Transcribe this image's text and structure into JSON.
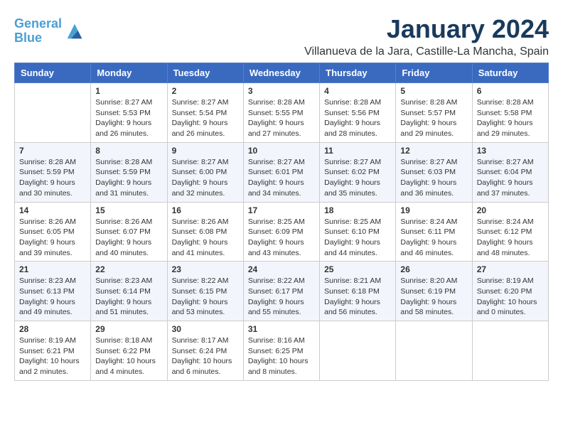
{
  "header": {
    "logo_line1": "General",
    "logo_line2": "Blue",
    "title": "January 2024",
    "subtitle": "Villanueva de la Jara, Castille-La Mancha, Spain"
  },
  "weekdays": [
    "Sunday",
    "Monday",
    "Tuesday",
    "Wednesday",
    "Thursday",
    "Friday",
    "Saturday"
  ],
  "weeks": [
    [
      {
        "day": "",
        "info": ""
      },
      {
        "day": "1",
        "info": "Sunrise: 8:27 AM\nSunset: 5:53 PM\nDaylight: 9 hours\nand 26 minutes."
      },
      {
        "day": "2",
        "info": "Sunrise: 8:27 AM\nSunset: 5:54 PM\nDaylight: 9 hours\nand 26 minutes."
      },
      {
        "day": "3",
        "info": "Sunrise: 8:28 AM\nSunset: 5:55 PM\nDaylight: 9 hours\nand 27 minutes."
      },
      {
        "day": "4",
        "info": "Sunrise: 8:28 AM\nSunset: 5:56 PM\nDaylight: 9 hours\nand 28 minutes."
      },
      {
        "day": "5",
        "info": "Sunrise: 8:28 AM\nSunset: 5:57 PM\nDaylight: 9 hours\nand 29 minutes."
      },
      {
        "day": "6",
        "info": "Sunrise: 8:28 AM\nSunset: 5:58 PM\nDaylight: 9 hours\nand 29 minutes."
      }
    ],
    [
      {
        "day": "7",
        "info": "Sunrise: 8:28 AM\nSunset: 5:59 PM\nDaylight: 9 hours\nand 30 minutes."
      },
      {
        "day": "8",
        "info": "Sunrise: 8:28 AM\nSunset: 5:59 PM\nDaylight: 9 hours\nand 31 minutes."
      },
      {
        "day": "9",
        "info": "Sunrise: 8:27 AM\nSunset: 6:00 PM\nDaylight: 9 hours\nand 32 minutes."
      },
      {
        "day": "10",
        "info": "Sunrise: 8:27 AM\nSunset: 6:01 PM\nDaylight: 9 hours\nand 34 minutes."
      },
      {
        "day": "11",
        "info": "Sunrise: 8:27 AM\nSunset: 6:02 PM\nDaylight: 9 hours\nand 35 minutes."
      },
      {
        "day": "12",
        "info": "Sunrise: 8:27 AM\nSunset: 6:03 PM\nDaylight: 9 hours\nand 36 minutes."
      },
      {
        "day": "13",
        "info": "Sunrise: 8:27 AM\nSunset: 6:04 PM\nDaylight: 9 hours\nand 37 minutes."
      }
    ],
    [
      {
        "day": "14",
        "info": "Sunrise: 8:26 AM\nSunset: 6:05 PM\nDaylight: 9 hours\nand 39 minutes."
      },
      {
        "day": "15",
        "info": "Sunrise: 8:26 AM\nSunset: 6:07 PM\nDaylight: 9 hours\nand 40 minutes."
      },
      {
        "day": "16",
        "info": "Sunrise: 8:26 AM\nSunset: 6:08 PM\nDaylight: 9 hours\nand 41 minutes."
      },
      {
        "day": "17",
        "info": "Sunrise: 8:25 AM\nSunset: 6:09 PM\nDaylight: 9 hours\nand 43 minutes."
      },
      {
        "day": "18",
        "info": "Sunrise: 8:25 AM\nSunset: 6:10 PM\nDaylight: 9 hours\nand 44 minutes."
      },
      {
        "day": "19",
        "info": "Sunrise: 8:24 AM\nSunset: 6:11 PM\nDaylight: 9 hours\nand 46 minutes."
      },
      {
        "day": "20",
        "info": "Sunrise: 8:24 AM\nSunset: 6:12 PM\nDaylight: 9 hours\nand 48 minutes."
      }
    ],
    [
      {
        "day": "21",
        "info": "Sunrise: 8:23 AM\nSunset: 6:13 PM\nDaylight: 9 hours\nand 49 minutes."
      },
      {
        "day": "22",
        "info": "Sunrise: 8:23 AM\nSunset: 6:14 PM\nDaylight: 9 hours\nand 51 minutes."
      },
      {
        "day": "23",
        "info": "Sunrise: 8:22 AM\nSunset: 6:15 PM\nDaylight: 9 hours\nand 53 minutes."
      },
      {
        "day": "24",
        "info": "Sunrise: 8:22 AM\nSunset: 6:17 PM\nDaylight: 9 hours\nand 55 minutes."
      },
      {
        "day": "25",
        "info": "Sunrise: 8:21 AM\nSunset: 6:18 PM\nDaylight: 9 hours\nand 56 minutes."
      },
      {
        "day": "26",
        "info": "Sunrise: 8:20 AM\nSunset: 6:19 PM\nDaylight: 9 hours\nand 58 minutes."
      },
      {
        "day": "27",
        "info": "Sunrise: 8:19 AM\nSunset: 6:20 PM\nDaylight: 10 hours\nand 0 minutes."
      }
    ],
    [
      {
        "day": "28",
        "info": "Sunrise: 8:19 AM\nSunset: 6:21 PM\nDaylight: 10 hours\nand 2 minutes."
      },
      {
        "day": "29",
        "info": "Sunrise: 8:18 AM\nSunset: 6:22 PM\nDaylight: 10 hours\nand 4 minutes."
      },
      {
        "day": "30",
        "info": "Sunrise: 8:17 AM\nSunset: 6:24 PM\nDaylight: 10 hours\nand 6 minutes."
      },
      {
        "day": "31",
        "info": "Sunrise: 8:16 AM\nSunset: 6:25 PM\nDaylight: 10 hours\nand 8 minutes."
      },
      {
        "day": "",
        "info": ""
      },
      {
        "day": "",
        "info": ""
      },
      {
        "day": "",
        "info": ""
      }
    ]
  ]
}
